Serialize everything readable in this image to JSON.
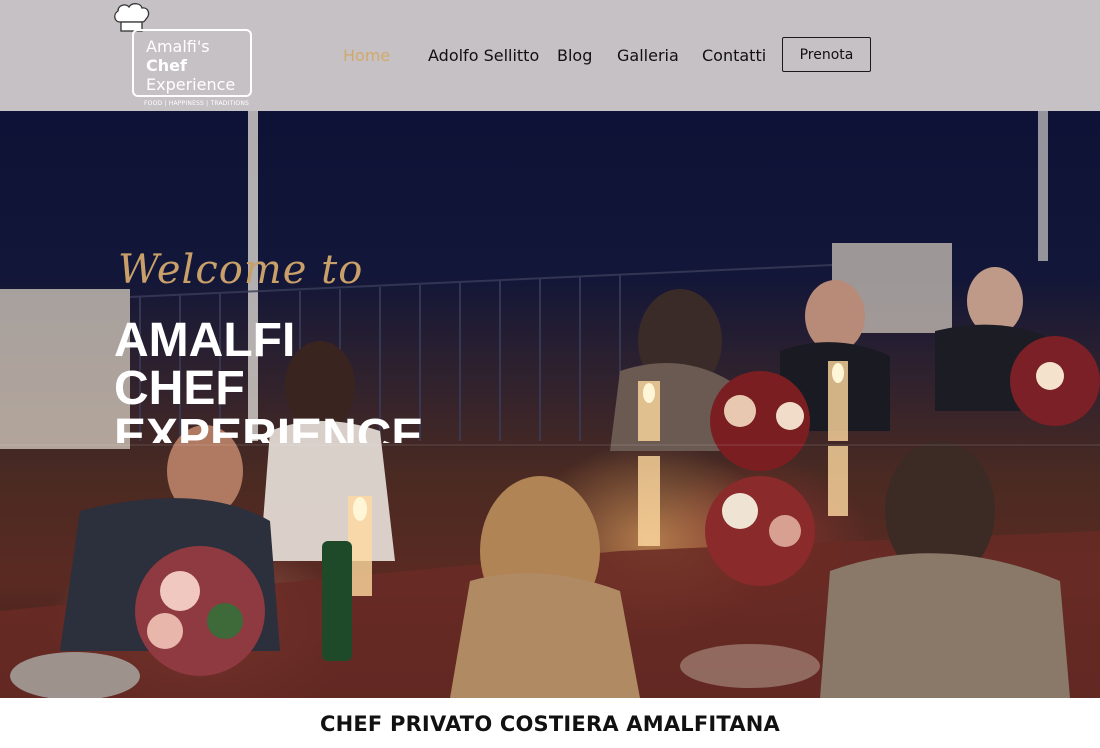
{
  "logo": {
    "line1": "Amalfi's",
    "line2": "Chef",
    "line3": "Experience",
    "tagline": "FOOD | HAPPINESS | TRADITIONS",
    "icon": "chef-hat-icon"
  },
  "nav": {
    "items": [
      {
        "label": "Home",
        "active": true
      },
      {
        "label": "Adolfo Sellitto",
        "active": false
      },
      {
        "label": "Blog",
        "active": false
      },
      {
        "label": "Galleria",
        "active": false
      },
      {
        "label": "Contatti",
        "active": false
      }
    ],
    "cta_label": "Prenota"
  },
  "hero": {
    "welcome": "Welcome to",
    "title_lines": [
      "AMALFI",
      "CHEF",
      "EXPERIENCE"
    ]
  },
  "section": {
    "title": "CHEF PRIVATO COSTIERA AMALFITANA"
  },
  "colors": {
    "header_bg": "#c6c1c5",
    "accent": "#d2a96c",
    "welcome": "#c9a06a"
  }
}
